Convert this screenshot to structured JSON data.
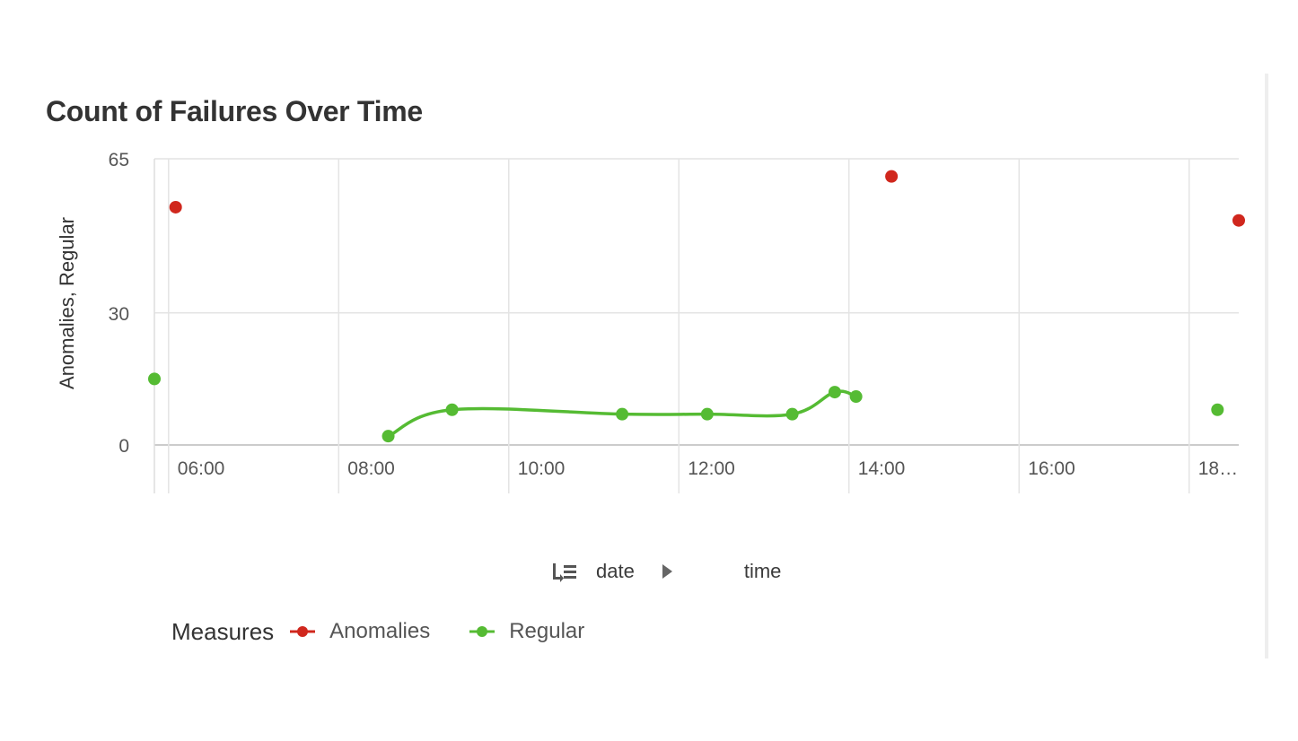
{
  "chart_data": {
    "type": "line",
    "title": "Count of Failures Over Time",
    "ylabel": "Anomalies, Regular",
    "xlabel": "",
    "x_tick_labels": [
      "06:00",
      "08:00",
      "10:00",
      "12:00",
      "14:00",
      "16:00",
      "18…"
    ],
    "y_tick_labels": [
      "0",
      "30",
      "65"
    ],
    "ylim": [
      0,
      65
    ],
    "xlim": [
      "05:50",
      "18:35"
    ],
    "grid": true,
    "legend_position": "bottom-left",
    "series": [
      {
        "name": "Anomalies",
        "color": "#d0271d",
        "style": "markers",
        "points": [
          {
            "x": "06:05",
            "y": 54
          },
          {
            "x": "14:30",
            "y": 61
          },
          {
            "x": "18:35",
            "y": 51
          }
        ]
      },
      {
        "name": "Regular",
        "color": "#55bb33",
        "style": "line+markers",
        "points": [
          {
            "x": "05:50",
            "y": 15,
            "segment": 0
          },
          {
            "x": "08:35",
            "y": 2,
            "segment": 1
          },
          {
            "x": "09:20",
            "y": 8,
            "segment": 1
          },
          {
            "x": "11:20",
            "y": 7,
            "segment": 1
          },
          {
            "x": "12:20",
            "y": 7,
            "segment": 1
          },
          {
            "x": "13:20",
            "y": 7,
            "segment": 1
          },
          {
            "x": "13:50",
            "y": 12,
            "segment": 1
          },
          {
            "x": "14:05",
            "y": 11,
            "segment": 1
          },
          {
            "x": "18:20",
            "y": 8,
            "segment": 2
          }
        ]
      }
    ]
  },
  "nav": {
    "drill_icon": "drill-hierarchy-icon",
    "chevron_icon": "chevron-right-icon",
    "level1": "date",
    "level2": "time"
  },
  "legend": {
    "title": "Measures"
  }
}
